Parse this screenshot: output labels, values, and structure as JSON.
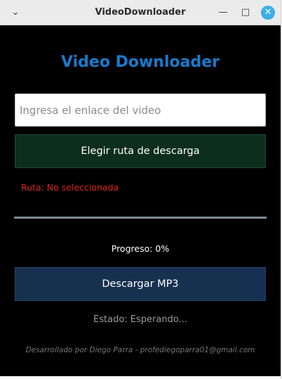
{
  "window": {
    "title": "VideoDownloader",
    "menu_icon": "chevron-down-icon",
    "minimize_icon": "minimize-icon",
    "maximize_icon": "maximize-icon",
    "close_icon": "close-icon",
    "close_color": "#3daee9"
  },
  "app": {
    "title": "Video Downloader",
    "title_color": "#1a7acc",
    "background": "#000000"
  },
  "url_input": {
    "value": "",
    "placeholder": "Ingresa el enlace del video"
  },
  "path_button": {
    "label": "Elegir ruta de descarga",
    "color": "#0d2e1d"
  },
  "path_status": {
    "text": "Ruta: No seleccionada",
    "color": "#e0241c"
  },
  "progress": {
    "value": 0,
    "text": "Progreso: 0%"
  },
  "download_button": {
    "label": "Descargar MP3",
    "color": "#163050"
  },
  "status": {
    "text": "Estado: Esperando..."
  },
  "footer": {
    "credit": "Desarrollado por Diego Parra - profediegoparra01@gmail.com"
  }
}
